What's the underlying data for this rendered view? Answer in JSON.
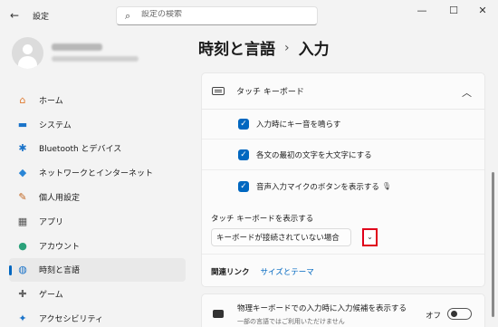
{
  "window": {
    "app_title": "設定",
    "minimize": "—",
    "maximize": "☐",
    "close": "✕"
  },
  "search": {
    "placeholder": "設定の検索"
  },
  "profile": {},
  "sidebar": {
    "items": [
      {
        "label": "ホーム",
        "icon": "home-icon",
        "glyph": "⌂",
        "color": "#e07a2f"
      },
      {
        "label": "システム",
        "icon": "monitor-icon",
        "glyph": "▬",
        "color": "#1a73c9"
      },
      {
        "label": "Bluetooth とデバイス",
        "icon": "bluetooth-icon",
        "glyph": "✱",
        "color": "#1a73c9"
      },
      {
        "label": "ネットワークとインターネット",
        "icon": "wifi-icon",
        "glyph": "◆",
        "color": "#2a86d6"
      },
      {
        "label": "個人用設定",
        "icon": "brush-icon",
        "glyph": "✎",
        "color": "#c0651f"
      },
      {
        "label": "アプリ",
        "icon": "apps-icon",
        "glyph": "▦",
        "color": "#555555"
      },
      {
        "label": "アカウント",
        "icon": "account-icon",
        "glyph": "●",
        "color": "#2aa17a"
      },
      {
        "label": "時刻と言語",
        "icon": "globe-clock-icon",
        "glyph": "◍",
        "color": "#1a73c9",
        "active": true
      },
      {
        "label": "ゲーム",
        "icon": "gamepad-icon",
        "glyph": "✚",
        "color": "#666666"
      },
      {
        "label": "アクセシビリティ",
        "icon": "accessibility-icon",
        "glyph": "✦",
        "color": "#1a73c9"
      }
    ]
  },
  "header": {
    "parent": "時刻と言語",
    "separator": "›",
    "current": "入力"
  },
  "touch_keyboard": {
    "title": "タッチ キーボード",
    "options": [
      {
        "label": "入力時にキー音を鳴らす",
        "checked": true
      },
      {
        "label": "各文の最初の文字を大文字にする",
        "checked": true
      },
      {
        "label": "音声入力マイクのボタンを表示する",
        "checked": true,
        "icon": "microphone-icon"
      }
    ],
    "show_label": "タッチ キーボードを表示する",
    "dropdown_value": "キーボードが接続されていない場合",
    "dropdown_chevron": "⌄",
    "checkmark": "✓",
    "mic_glyph": "🎙"
  },
  "related": {
    "label": "関連リンク",
    "link": "サイズとテーマ"
  },
  "physical_keyboard": {
    "title": "物理キーボードでの入力時に入力候補を表示する",
    "subtitle": "一部の言語ではご利用いただけません",
    "toggle_label": "オフ",
    "toggle_on": false
  },
  "colors": {
    "accent": "#0067c0",
    "highlight_box": "#e0001a"
  }
}
